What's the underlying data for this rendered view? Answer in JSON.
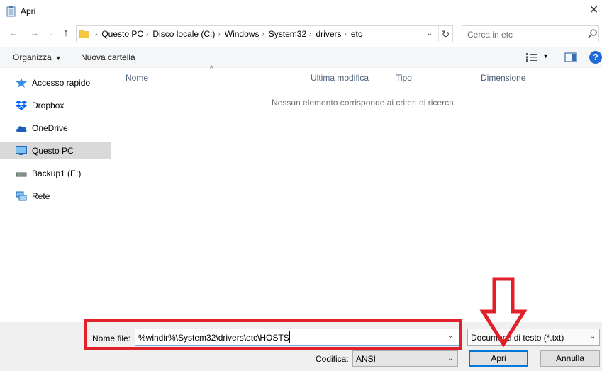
{
  "window": {
    "title": "Apri"
  },
  "address": {
    "crumbs": [
      "Questo PC",
      "Disco locale (C:)",
      "Windows",
      "System32",
      "drivers",
      "etc"
    ]
  },
  "search": {
    "placeholder": "Cerca in etc"
  },
  "toolbar": {
    "organize": "Organizza",
    "new_folder": "Nuova cartella"
  },
  "sidebar": {
    "items": [
      {
        "label": "Accesso rapido",
        "icon": "star-icon"
      },
      {
        "label": "Dropbox",
        "icon": "dropbox-icon"
      },
      {
        "label": "OneDrive",
        "icon": "cloud-icon"
      },
      {
        "label": "Questo PC",
        "icon": "computer-icon",
        "selected": true
      },
      {
        "label": "Backup1 (E:)",
        "icon": "drive-icon"
      },
      {
        "label": "Rete",
        "icon": "network-icon"
      }
    ]
  },
  "columns": [
    "Nome",
    "Ultima modifica",
    "Tipo",
    "Dimensione"
  ],
  "empty_message": "Nessun elemento corrisponde ai criteri di ricerca.",
  "filename": {
    "label": "Nome file:",
    "value": "%windir%\\System32\\drivers\\etc\\HOSTS"
  },
  "filetype": {
    "value": "Documenti di testo (*.txt)"
  },
  "encoding": {
    "label": "Codifica:",
    "value": "ANSI"
  },
  "buttons": {
    "open": "Apri",
    "cancel": "Annulla"
  },
  "colors": {
    "accent": "#0078d7",
    "highlight": "#e0202a",
    "selected_bg": "#d9d9d9"
  }
}
